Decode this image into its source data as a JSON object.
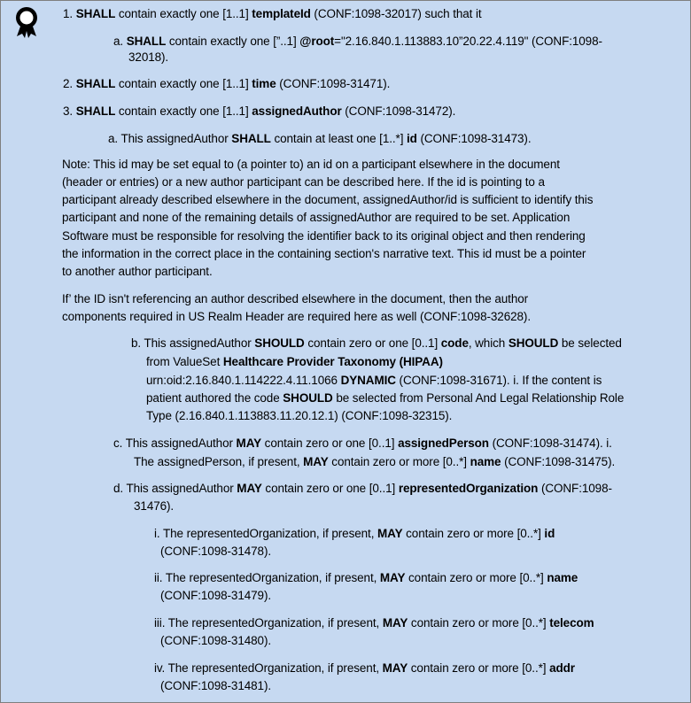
{
  "icon": "award-ribbon-icon",
  "colors": {
    "background": "#c6d9f1",
    "border": "#7f7f7f",
    "text": "#000000"
  },
  "items": {
    "i1": {
      "num": "1.",
      "pre": "SHALL",
      "t1": " contain exactly one [1..1] ",
      "k1": "templateId",
      "t2": " (CONF:1098-32017) such that it"
    },
    "i1a": {
      "num": "a.",
      "pre": "SHALL",
      "t1": " contain exactly one [”..1] ",
      "k1": "@root",
      "t2": "=\"2.16.840.1.113883.10”20.22.4.119\" (CONF:1098-",
      "t3": "32018)."
    },
    "i2": {
      "num": "2.",
      "pre": "SHALL",
      "t1": " contain exactly one [1..1] ",
      "k1": "time",
      "t2": " (CONF:1098-31471)."
    },
    "i3": {
      "num": "3.",
      "pre": "SHALL",
      "t1": " contain exactly one [1..1] ",
      "k1": "assignedAuthor",
      "t2": " (CONF:1098-31472)."
    },
    "i3a": {
      "num": "a.",
      "t0": " This assignedAuthor ",
      "pre": "SHALL",
      "t1": " contain at least one [1..*] ",
      "k1": "id",
      "t2": " (CONF:1098-31473)."
    },
    "note": [
      "Note: This id may be set equal to (a pointer to) an id on a participant elsewhere in the document",
      "(header or entries) or a new author participant can be described here. If the id is pointing to a",
      "participant already described elsewhere in the document, assignedAuthor/id is sufficient to identify this",
      "participant and none of the remaining details of assignedAuthor are required to be set. Application",
      "Software must be responsible for resolving the identifier back to its original object and then rendering",
      "the information in the correct place in the containing section's narrative text. This id must be a pointer",
      "to another author participant."
    ],
    "if_note": [
      "If’ the ID isn't referencing an author described elsewhere in the document, then the author",
      "components required in US Realm Header are required here as well (CONF:1098-32628)."
    ],
    "i3b": {
      "l1_num": "b.",
      "l1_t0": " This assignedAuthor ",
      "l1_k0": "SHOULD",
      "l1_t1": " contain zero or one [0..1] ",
      "l1_k1": "code",
      "l1_t2": ", which ",
      "l1_k2": "SHOULD",
      "l1_t3": " be selected",
      "l2_t0": "from ValueSet ",
      "l2_k0": "Healthcare Provider Taxonomy (HIPAA)",
      "l3_t0": "urn:oid:2.16.840.1.114222.4.11.1066 ",
      "l3_k0": "DYNAMIC",
      "l3_t1": " (CONF:1098-31671). i. If the content is",
      "l4_t0": "patient authored the code ",
      "l4_k0": "SHOULD",
      "l4_t1": " be selected from Personal And Legal Relationship Role",
      "l5_t0": "Type (2.16.840.1.113883.11.20.12.1) (CONF:1098-32315)."
    },
    "i3c": {
      "l1_num": "c.",
      "l1_t0": " This assignedAuthor ",
      "l1_k0": "MAY",
      "l1_t1": " contain zero or one [0..1] ",
      "l1_k1": "assignedPerson",
      "l1_t2": " (CONF:1098-31474). i.",
      "l2_t0": "The assignedPerson, if present, ",
      "l2_k0": "MAY",
      "l2_t1": " contain zero or more [0..*] ",
      "l2_k1": "name",
      "l2_t2": " (CONF:1098-31475)."
    },
    "i3d": {
      "l1_num": "d.",
      "l1_t0": " This assignedAuthor ",
      "l1_k0": "MAY",
      "l1_t1": " contain zero or one [0..1] ",
      "l1_k1": "representedOrganization",
      "l1_t2": " (CONF:1098-",
      "l2_t0": "31476)."
    },
    "sub": [
      {
        "num": "i.",
        "t0": " The representedOrganization, if present, ",
        "k0": "MAY",
        "t1": " contain zero or more [0..*] ",
        "k1": "id",
        "conf": "(CONF:1098-31478)."
      },
      {
        "num": "ii.",
        "t0": " The representedOrganization, if present, ",
        "k0": "MAY",
        "t1": " contain zero or more [0..*] ",
        "k1": "name",
        "conf": "(CONF:1098-31479)."
      },
      {
        "num": "iii.",
        "t0": " The representedOrganization, if present, ",
        "k0": "MAY",
        "t1": " contain zero or more [0..*] ",
        "k1": "telecom",
        "conf": "(CONF:1098-31480)."
      },
      {
        "num": "iv.",
        "t0": " The representedOrganization, if present, ",
        "k0": "MAY",
        "t1": " contain zero or more [0..*] ",
        "k1": "addr",
        "conf": "(CONF:1098-31481)."
      }
    ]
  }
}
